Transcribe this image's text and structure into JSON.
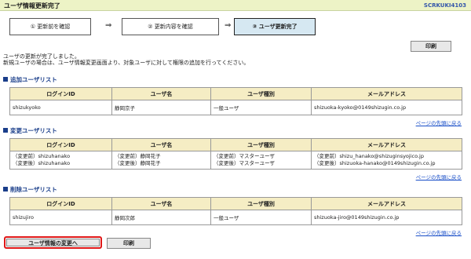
{
  "header": {
    "title": "ユーザ情報更新完了",
    "screen_id": "SCRKUKI4103"
  },
  "steps": [
    {
      "label": "① 更新前を確認"
    },
    {
      "label": "② 更新内容を確認"
    },
    {
      "label": "③ ユーザ更新完了"
    }
  ],
  "arrow": "⇒",
  "print_label": "印刷",
  "message": {
    "line1": "ユーザの更新が完了しました。",
    "line2": "新規ユーザの場合は、ユーザ情報変更画面より、対象ユーザに対して権限の追加を行ってください。"
  },
  "columns": [
    "ログインID",
    "ユーザ名",
    "ユーザ種別",
    "メールアドレス"
  ],
  "sections": {
    "added": {
      "title": "追加ユーザリスト",
      "rows": [
        {
          "login": "shizukyoko",
          "name": "静岡京子",
          "type": "一般ユーザ",
          "email": "shizuoka-kyoko@0149shizugin.co.jp"
        }
      ]
    },
    "changed": {
      "title": "変更ユーザリスト",
      "rows": [
        {
          "login_before": "（変更前）shizuhanako",
          "login_after": "（変更後）shizuhanako",
          "name_before": "（変更前）静岡花子",
          "name_after": "（変更後）静岡花子",
          "type_before": "（変更前）マスターユーザ",
          "type_after": "（変更後）マスターユーザ",
          "email_before": "（変更前）shizu_hanako@shizuginsyojico.jp",
          "email_after": "（変更後）shizuoka-hanako@0149shizugin.co.jp"
        }
      ]
    },
    "deleted": {
      "title": "削除ユーザリスト",
      "rows": [
        {
          "login": "shizujiro",
          "name": "静岡次郎",
          "type": "一般ユーザ",
          "email": "shizuoka-jiro@0149shizugin.co.jp"
        }
      ]
    }
  },
  "page_top_link": "ページの先頭に戻る",
  "footer": {
    "change_label": "ユーザ情報の変更へ",
    "print_label": "印刷"
  },
  "colors": {
    "title_bg": "#edf3c6",
    "table_header_bg": "#f5edc4",
    "active_step_bg": "#d6e8f2",
    "section_heading": "#1a3e8a",
    "highlight_border": "#e01818"
  }
}
